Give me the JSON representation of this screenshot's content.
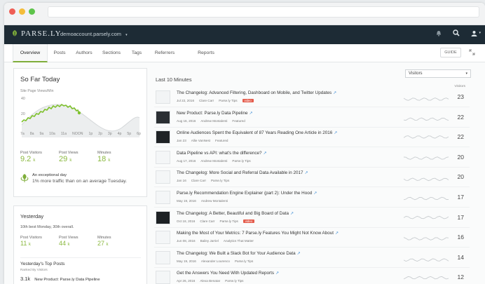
{
  "browser": {
    "dots": [
      "#ef5e55",
      "#f4bd3a",
      "#5ec44b"
    ]
  },
  "topbar": {
    "logo": "PARSE.LY",
    "site": "demoaccount.parsely.com"
  },
  "nav": {
    "tabs": [
      "Overview",
      "Posts",
      "Authors",
      "Sections",
      "Tags",
      "Referrers",
      "Reports"
    ],
    "guide": "GUIDE"
  },
  "so_far_today": {
    "title": "So Far Today",
    "chart_label": "Site Page Views/Min",
    "y_ticks": [
      "40",
      "20"
    ],
    "x_ticks": [
      "7a",
      "8a",
      "9a",
      "10a",
      "11a",
      "NOON",
      "1p",
      "2p",
      "3p",
      "4p",
      "5p",
      "6p"
    ],
    "stats": [
      {
        "label": "Post Visitors",
        "value": "9.2",
        "unit": "k"
      },
      {
        "label": "Post Views",
        "value": "29",
        "unit": "k"
      },
      {
        "label": "Minutes",
        "value": "18",
        "unit": "k"
      }
    ],
    "exceptional": "An exceptional day",
    "exceptional_sub": "1% more traffic than on an average Tuesday."
  },
  "yesterday": {
    "title": "Yesterday",
    "subtitle": "10th best Monday, 30th overall.",
    "stats": [
      {
        "label": "Post Visitors",
        "value": "11",
        "unit": "k"
      },
      {
        "label": "Post Views",
        "value": "44",
        "unit": "k"
      },
      {
        "label": "Minutes",
        "value": "27",
        "unit": "k"
      }
    ],
    "top_posts_title": "Yesterday's Top Posts",
    "top_posts_sub": "Ranked By Visitors",
    "top_post_value": "3.1k",
    "top_post_title": "New Product: Parse.ly Data Pipeline"
  },
  "main": {
    "title": "Last 10 Minutes",
    "select_value": "Visitors",
    "column_label": "Visitors",
    "rows": [
      {
        "title": "The Changelog: Advanced Filtering, Dashboard on Mobile, and Twitter Updates",
        "date": "Jul 22, 2016",
        "author": "Clare Carr",
        "section": "Parse.ly Tips",
        "badge": "video",
        "value": "23"
      },
      {
        "title": "New Product: Parse.ly Data Pipeline",
        "date": "Aug 16, 2016",
        "author": "Andrew Montalenti",
        "section": "Featured",
        "badge": "",
        "value": "22"
      },
      {
        "title": "Online Audiences Spent the Equivalent of 87 Years Reading One Article in 2016",
        "date": "Jan 23",
        "author": "Allie VanNest",
        "section": "Featured",
        "badge": "",
        "value": "22"
      },
      {
        "title": "Data Pipeline vs API: what's the difference?",
        "date": "Aug 17, 2016",
        "author": "Andrew Montalenti",
        "section": "Parse.ly Tips",
        "badge": "",
        "value": "20"
      },
      {
        "title": "The Changelog: More Social and Referral Data Available in 2017",
        "date": "Jan 16",
        "author": "Clare Carr",
        "section": "Parse.ly Tips",
        "badge": "",
        "value": "20"
      },
      {
        "title": "Parse.ly Recommendation Engine Explainer (part 2): Under the Hood",
        "date": "May 19, 2016",
        "author": "Andrew Montalenti",
        "section": "",
        "badge": "",
        "value": "17"
      },
      {
        "title": "The Changelog: A Better, Beautiful and Big Board of Data",
        "date": "Oct 18, 2016",
        "author": "Clare Carr",
        "section": "Parse.ly Tips",
        "badge": "video",
        "value": "17"
      },
      {
        "title": "Making the Most of Your Metrics: 7 Parse.ly Features You Might Not Know About",
        "date": "Jun 08, 2016",
        "author": "Bailey Jarriel",
        "section": "Analytics That Matter",
        "badge": "",
        "value": "16"
      },
      {
        "title": "The Changelog: We Built a Slack Bot for Your Audience Data",
        "date": "May 19, 2016",
        "author": "Alexander Lourenco",
        "section": "Parse.ly Tips",
        "badge": "",
        "value": "14"
      },
      {
        "title": "Get the Answers You Need With Updated Reports",
        "date": "Apr 26, 2016",
        "author": "Alexa Benatar",
        "section": "Parse.ly Tips",
        "badge": "",
        "value": "12"
      }
    ]
  },
  "icons": [
    "leaf-logo-icon",
    "bell-icon",
    "search-icon",
    "user-icon",
    "chevron-down-icon",
    "expand-icon",
    "link-icon",
    "trophy-icon"
  ],
  "colors": {
    "accent": "#8ab83f",
    "navbar": "#1d2b35",
    "link": "#3f8ed6",
    "badge": "#e45c4c"
  }
}
